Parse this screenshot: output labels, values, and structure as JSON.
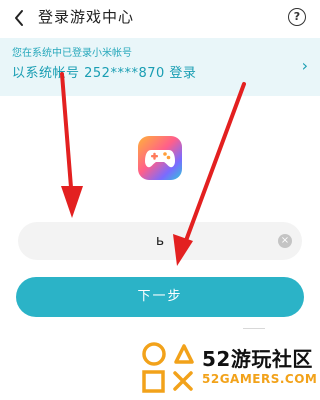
{
  "header": {
    "title": "登录游戏中心",
    "back_icon": "back-arrow-icon",
    "help_icon": "help-icon",
    "help_glyph": "?"
  },
  "banner": {
    "hint": "您在系统中已登录小米帐号",
    "login_text": "以系统帐号 252****870 登录",
    "chevron_glyph": "›"
  },
  "app_icon": {
    "name": "game-center-icon"
  },
  "input": {
    "value": "ь",
    "clear_glyph": "×"
  },
  "next_button": {
    "label": "下一步"
  },
  "colors": {
    "accent": "#2bb3c7",
    "banner_bg": "#e9f6f9",
    "arrow_red": "#e32020",
    "watermark_orange": "#f2a21a"
  },
  "watermark": {
    "title": "52游玩社区",
    "subtitle": "52GAMERS.COM"
  }
}
